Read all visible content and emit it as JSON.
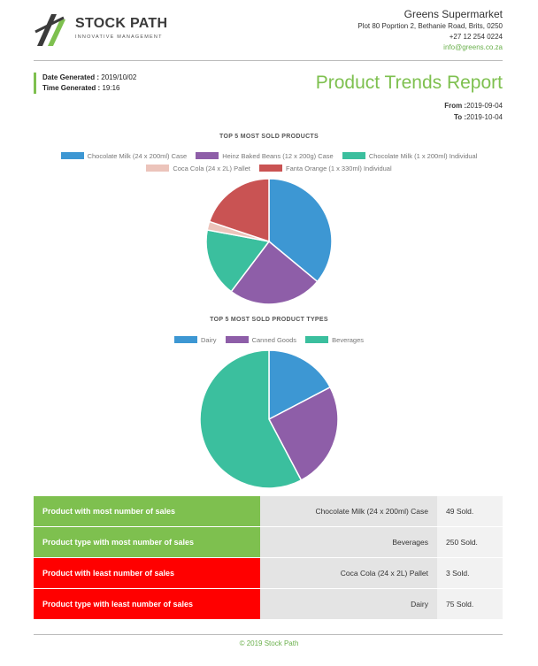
{
  "brand": {
    "name": "STOCK PATH",
    "tagline": "INNOVATIVE MANAGEMENT",
    "icon": "stock-path-logo-icon",
    "accent_color": "#7ec04f"
  },
  "company": {
    "name": "Greens Supermarket",
    "address": "Plot 80 Poprtion 2, Bethanie Road, Brits, 0250",
    "phone": "+27 12 254 0224",
    "email": "info@greens.co.za"
  },
  "generated": {
    "date_label": "Date Generated :",
    "date_value": "2019/10/02",
    "time_label": "Time Generated :",
    "time_value": "19:16"
  },
  "report": {
    "title": "Product Trends Report",
    "from_label": "From :",
    "from_value": "2019-09-04",
    "to_label": "To :",
    "to_value": "2019-10-04"
  },
  "chart_data": [
    {
      "type": "pie",
      "title": "TOP 5 MOST SOLD PRODUCTS",
      "legend_position": "top",
      "categories": [
        "Chocolate Milk (24 x 200ml) Case",
        "Heinz Baked Beans (12 x 200g) Case",
        "Chocolate Milk (1 x 200ml) Individual",
        "Coca Cola (24 x 2L) Pallet",
        "Fanta Orange (1 x 330ml) Individual"
      ],
      "values": [
        49,
        33,
        24,
        3,
        27
      ],
      "colors": [
        "#3d97d3",
        "#8e5ea8",
        "#3bbf9e",
        "#ecc4bb",
        "#c95353"
      ]
    },
    {
      "type": "pie",
      "title": "TOP 5 MOST SOLD PRODUCT TYPES",
      "legend_position": "top",
      "categories": [
        "Dairy",
        "Canned Goods",
        "Beverages"
      ],
      "values": [
        75,
        108,
        250
      ],
      "colors": [
        "#3d97d3",
        "#8e5ea8",
        "#3bbf9e"
      ]
    }
  ],
  "summary": {
    "rows": [
      {
        "label": "Product with most number of sales",
        "value": "Chocolate Milk (24 x 200ml) Case",
        "count": "49 Sold.",
        "color": "#7ec04f"
      },
      {
        "label": "Product type with most number of sales",
        "value": "Beverages",
        "count": "250 Sold.",
        "color": "#7ec04f"
      },
      {
        "label": "Product with least number of sales",
        "value": "Coca Cola (24 x 2L) Pallet",
        "count": "3 Sold.",
        "color": "#ff0000"
      },
      {
        "label": "Product type with least number of sales",
        "value": "Dairy",
        "count": "75 Sold.",
        "color": "#ff0000"
      }
    ]
  },
  "footer": {
    "text": "© 2019 Stock Path"
  }
}
